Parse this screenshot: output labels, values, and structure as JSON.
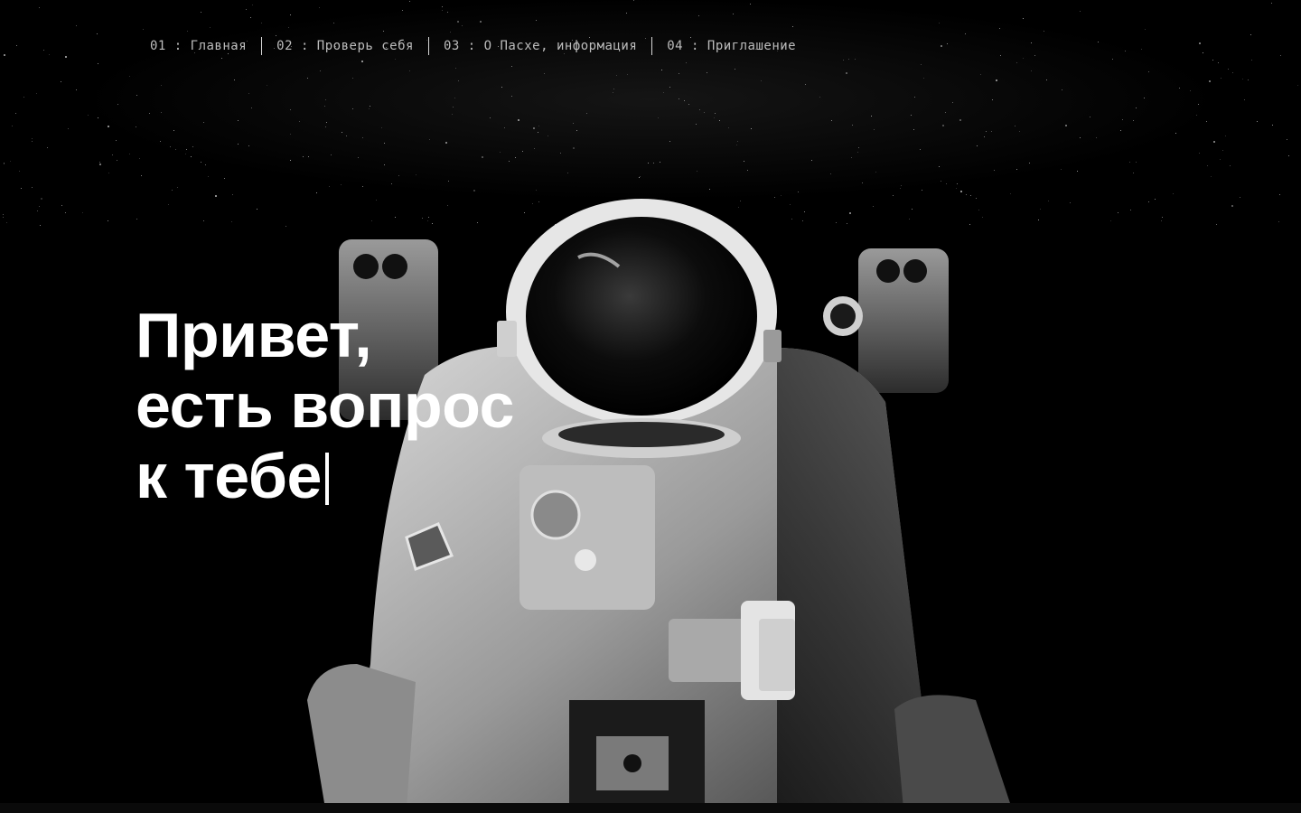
{
  "nav": {
    "items": [
      {
        "label": "01 : Главная"
      },
      {
        "label": "02 : Проверь себя"
      },
      {
        "label": "03 : О Пасхе, информация"
      },
      {
        "label": "04 : Приглашение"
      }
    ]
  },
  "hero": {
    "line1": "Привет,",
    "line2": "есть вопрос",
    "line3": "к тебе"
  },
  "colors": {
    "background": "#000000",
    "text": "#ffffff",
    "nav_text": "#bdbdbd"
  },
  "icons": {
    "background_image": "astronaut-photo"
  }
}
